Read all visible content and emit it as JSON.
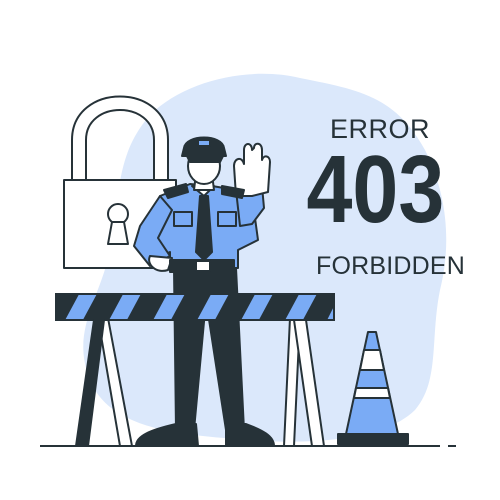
{
  "error": {
    "label": "ERROR",
    "code": "403",
    "status": "FORBIDDEN"
  },
  "colors": {
    "accent": "#4a8ff0",
    "accent_light": "#dbe8fb",
    "ink": "#263238",
    "shirt": "#7aabf5",
    "pants": "#263238",
    "skin": "#ffffff"
  },
  "icons": [
    "padlock-icon",
    "security-guard",
    "barrier",
    "traffic-cone"
  ]
}
